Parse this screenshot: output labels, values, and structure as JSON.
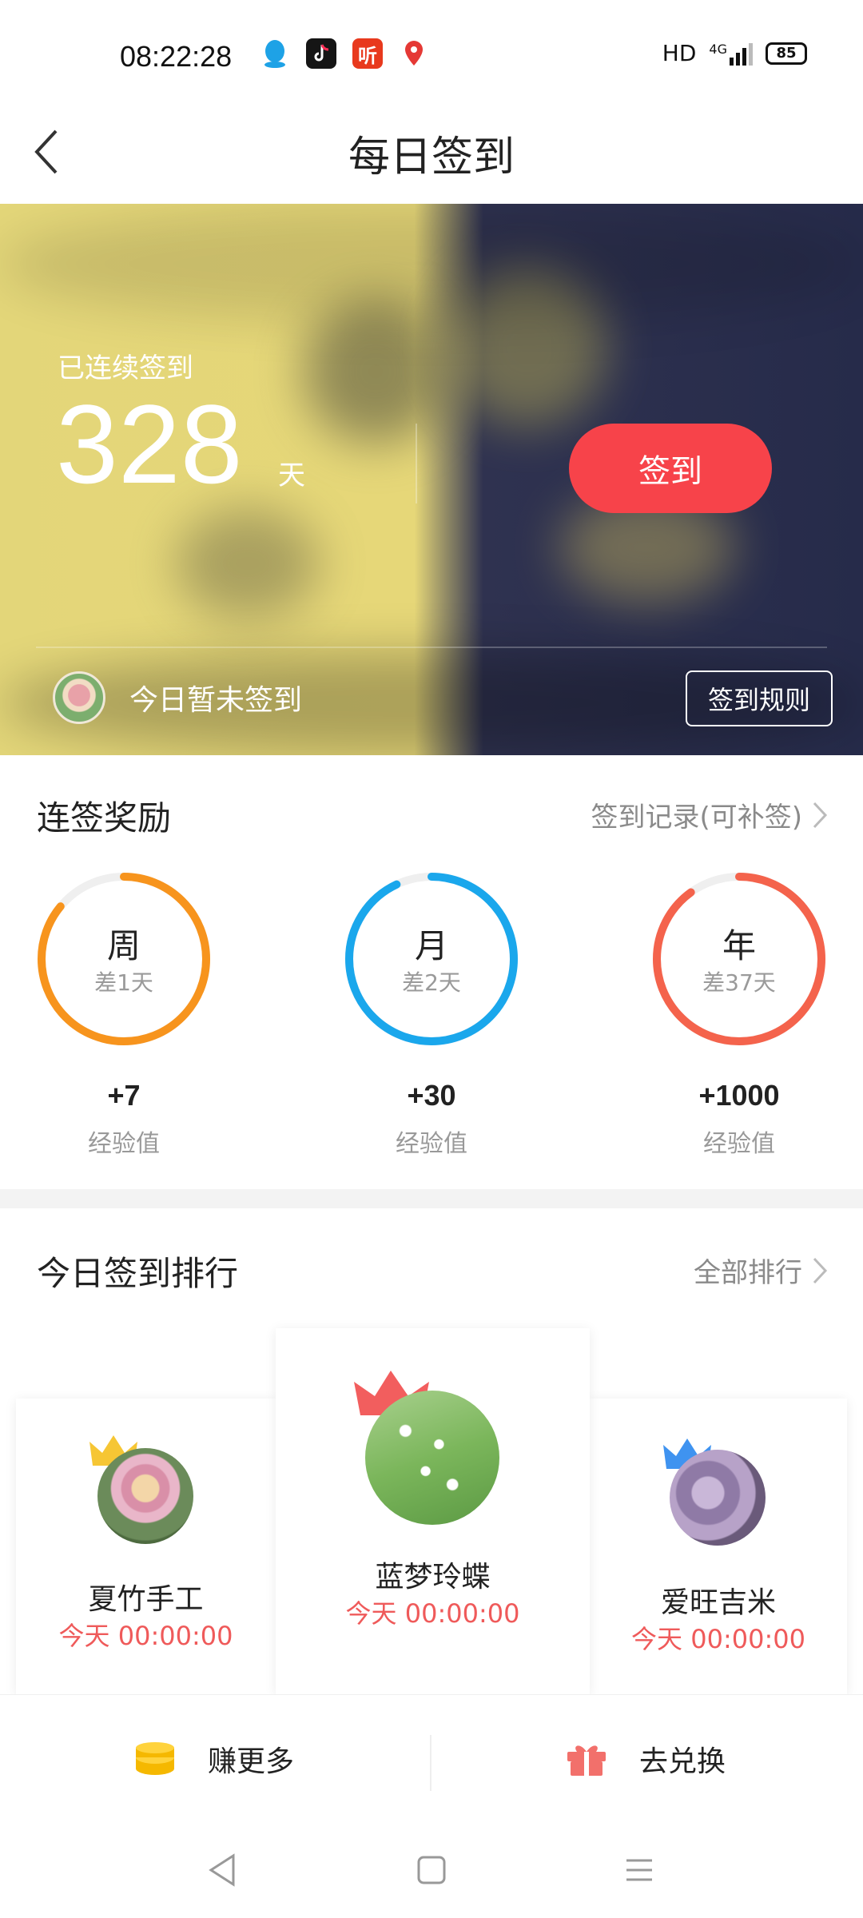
{
  "status_bar": {
    "time": "08:22:28",
    "network": "HD",
    "signal_label": "4G",
    "battery": "85",
    "apps": [
      {
        "icon": "qq-icon",
        "color": "#1ea2e6"
      },
      {
        "icon": "tiktok-icon",
        "color": "#151515"
      },
      {
        "icon": "ting-icon",
        "label": "听",
        "color": "#e8391d"
      },
      {
        "icon": "du-location-icon",
        "color": "#e53935"
      }
    ]
  },
  "nav": {
    "title": "每日签到",
    "back_icon": "chevron-left-icon"
  },
  "banner": {
    "caption": "已连续签到",
    "days": "328",
    "unit": "天",
    "button_label": "签到",
    "status_text": "今日暂未签到",
    "rules_label": "签到规则",
    "colors": {
      "button": "#f7434a"
    }
  },
  "rewards": {
    "title": "连签奖励",
    "link_label": "签到记录(可补签)",
    "items": [
      {
        "label": "周",
        "sub": "差1天",
        "reward": "+7",
        "unit": "经验值",
        "color": "#f7941d",
        "progress": 0.86
      },
      {
        "label": "月",
        "sub": "差2天",
        "reward": "+30",
        "unit": "经验值",
        "color": "#1aa7ec",
        "progress": 0.93
      },
      {
        "label": "年",
        "sub": "差37天",
        "reward": "+1000",
        "unit": "经验值",
        "color": "#f4634c",
        "progress": 0.9
      }
    ]
  },
  "ranking": {
    "title": "今日签到排行",
    "link_label": "全部排行",
    "entries": [
      {
        "rank": 2,
        "name": "夏竹手工",
        "time": "今天 00:00:00",
        "crown_color": "#f6c634"
      },
      {
        "rank": 1,
        "name": "蓝梦玲蝶",
        "time": "今天 00:00:00",
        "crown_color": "#f25e5e"
      },
      {
        "rank": 3,
        "name": "爱旺吉米",
        "time": "今天 00:00:00",
        "crown_color": "#3f93f0"
      }
    ]
  },
  "bottom": {
    "earn_label": "赚更多",
    "exchange_label": "去兑换",
    "earn_icon": "coin-stack-icon",
    "exchange_icon": "gift-icon"
  }
}
